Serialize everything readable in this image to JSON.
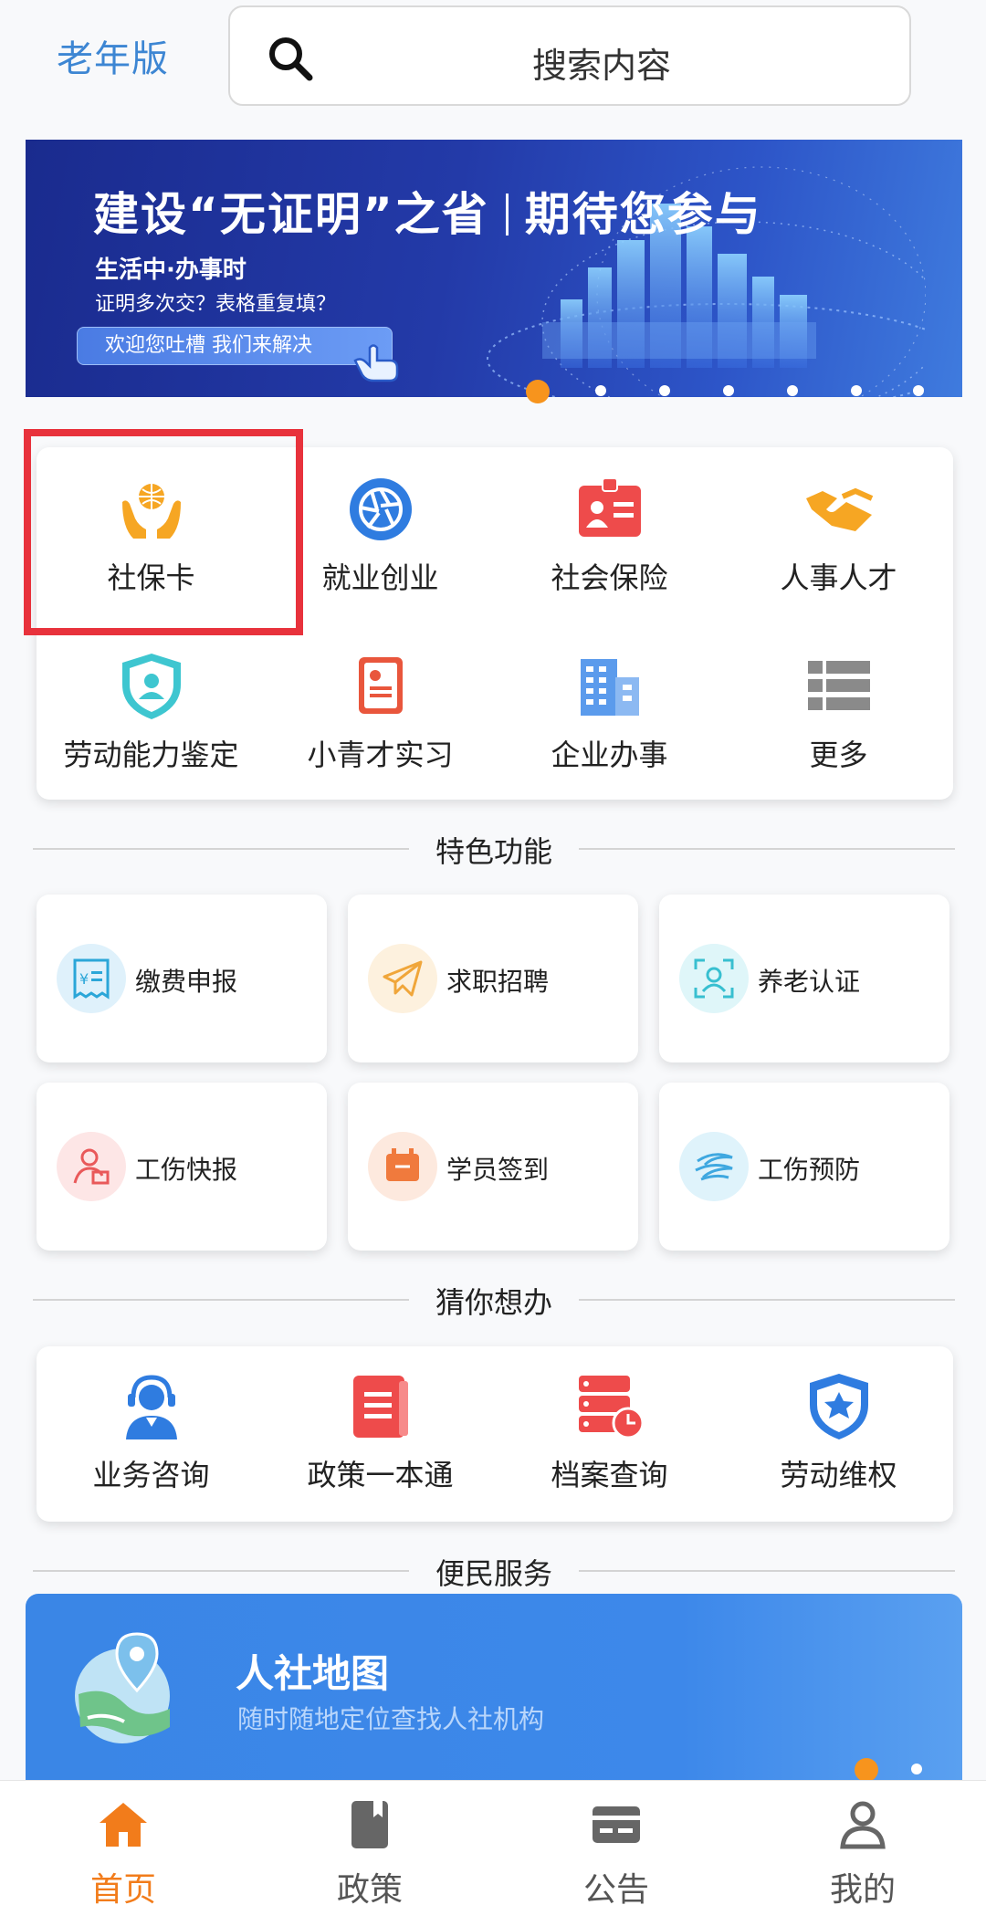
{
  "header": {
    "elder_mode_label": "老年版",
    "search_placeholder": "搜索内容"
  },
  "banner": {
    "title_left": "建设“无证明”之省",
    "title_right": "期待您参与",
    "line1": "生活中·办事时",
    "line2": "证明多次交？表格重复填？",
    "button": "欢迎您吐槽 我们来解决"
  },
  "main_grid": {
    "items": [
      {
        "label": "社保卡",
        "icon": "hands-globe-icon"
      },
      {
        "label": "就业创业",
        "icon": "aperture-icon"
      },
      {
        "label": "社会保险",
        "icon": "id-badge-icon"
      },
      {
        "label": "人事人才",
        "icon": "handshake-icon"
      },
      {
        "label": "劳动能力鉴定",
        "icon": "shield-person-icon"
      },
      {
        "label": "小青才实习",
        "icon": "resume-icon"
      },
      {
        "label": "企业办事",
        "icon": "building-icon"
      },
      {
        "label": "更多",
        "icon": "list-grid-icon"
      }
    ]
  },
  "sections": {
    "features": "特色功能",
    "guess": "猜你想办",
    "services": "便民服务"
  },
  "features": {
    "items": [
      {
        "label": "缴费申报",
        "icon": "payment-receipt-icon"
      },
      {
        "label": "求职招聘",
        "icon": "paper-plane-icon"
      },
      {
        "label": "养老认证",
        "icon": "face-scan-icon"
      },
      {
        "label": "工伤快报",
        "icon": "injury-report-icon"
      },
      {
        "label": "学员签到",
        "icon": "calendar-checkin-icon"
      },
      {
        "label": "工伤预防",
        "icon": "swirl-icon"
      }
    ]
  },
  "guess": {
    "items": [
      {
        "label": "业务咨询",
        "icon": "headset-agent-icon"
      },
      {
        "label": "政策一本通",
        "icon": "book-icon"
      },
      {
        "label": "档案查询",
        "icon": "archive-clock-icon"
      },
      {
        "label": "劳动维权",
        "icon": "shield-star-icon"
      }
    ]
  },
  "map_banner": {
    "title": "人社地图",
    "subtitle": "随时随地定位查找人社机构"
  },
  "bottom_nav": {
    "items": [
      {
        "label": "首页",
        "icon": "home-icon",
        "active": true
      },
      {
        "label": "政策",
        "icon": "book-icon",
        "active": false
      },
      {
        "label": "公告",
        "icon": "card-icon",
        "active": false
      },
      {
        "label": "我的",
        "icon": "person-icon",
        "active": false
      }
    ]
  },
  "colors": {
    "accent_orange": "#f27c1b",
    "primary_blue": "#3d86d3",
    "highlight_red": "#e8323c"
  }
}
